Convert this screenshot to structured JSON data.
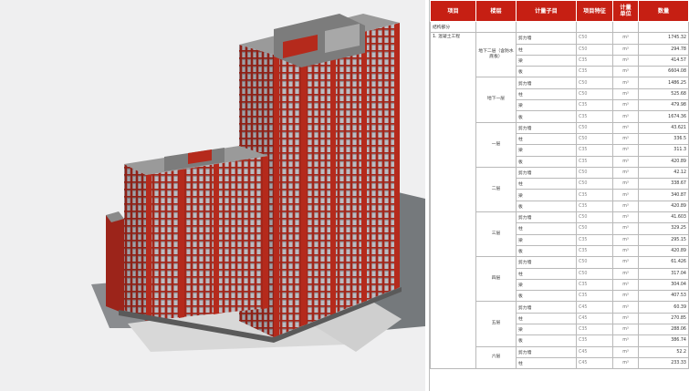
{
  "table": {
    "headers": [
      "项目",
      "楼层",
      "计量子目",
      "项目特征",
      "计量\n单位",
      "数量"
    ],
    "section": "结构部分",
    "item": "1. 混凝土工程",
    "floors": [
      {
        "name": "地下二层（含防水底板）",
        "rows": [
          {
            "sub": "剪力墙",
            "grade": "C50",
            "unit": "m³",
            "qty": "1745.32"
          },
          {
            "sub": "柱",
            "grade": "C50",
            "unit": "m³",
            "qty": "294.78"
          },
          {
            "sub": "梁",
            "grade": "C35",
            "unit": "m³",
            "qty": "414.57"
          },
          {
            "sub": "板",
            "grade": "C35",
            "unit": "m³",
            "qty": "6604.08"
          }
        ]
      },
      {
        "name": "地下一层",
        "rows": [
          {
            "sub": "剪力墙",
            "grade": "C50",
            "unit": "m³",
            "qty": "1486.25"
          },
          {
            "sub": "柱",
            "grade": "C50",
            "unit": "m³",
            "qty": "525.68"
          },
          {
            "sub": "梁",
            "grade": "C35",
            "unit": "m³",
            "qty": "479.98"
          },
          {
            "sub": "板",
            "grade": "C35",
            "unit": "m³",
            "qty": "1674.36"
          }
        ]
      },
      {
        "name": "一层",
        "rows": [
          {
            "sub": "剪力墙",
            "grade": "C50",
            "unit": "m³",
            "qty": "43.621"
          },
          {
            "sub": "柱",
            "grade": "C50",
            "unit": "m³",
            "qty": "336.5"
          },
          {
            "sub": "梁",
            "grade": "C35",
            "unit": "m³",
            "qty": "311.3"
          },
          {
            "sub": "板",
            "grade": "C35",
            "unit": "m³",
            "qty": "420.89"
          }
        ]
      },
      {
        "name": "二层",
        "rows": [
          {
            "sub": "剪力墙",
            "grade": "C50",
            "unit": "m³",
            "qty": "42.12"
          },
          {
            "sub": "柱",
            "grade": "C50",
            "unit": "m³",
            "qty": "338.67"
          },
          {
            "sub": "梁",
            "grade": "C35",
            "unit": "m³",
            "qty": "340.87"
          },
          {
            "sub": "板",
            "grade": "C35",
            "unit": "m³",
            "qty": "420.89"
          }
        ]
      },
      {
        "name": "三层",
        "rows": [
          {
            "sub": "剪力墙",
            "grade": "C50",
            "unit": "m³",
            "qty": "41.603"
          },
          {
            "sub": "柱",
            "grade": "C50",
            "unit": "m³",
            "qty": "329.25"
          },
          {
            "sub": "梁",
            "grade": "C35",
            "unit": "m³",
            "qty": "295.15"
          },
          {
            "sub": "板",
            "grade": "C35",
            "unit": "m³",
            "qty": "420.89"
          }
        ]
      },
      {
        "name": "四层",
        "rows": [
          {
            "sub": "剪力墙",
            "grade": "C50",
            "unit": "m³",
            "qty": "61.426"
          },
          {
            "sub": "柱",
            "grade": "C50",
            "unit": "m³",
            "qty": "317.04"
          },
          {
            "sub": "梁",
            "grade": "C35",
            "unit": "m³",
            "qty": "304.04"
          },
          {
            "sub": "板",
            "grade": "C35",
            "unit": "m³",
            "qty": "407.53"
          }
        ]
      },
      {
        "name": "五层",
        "rows": [
          {
            "sub": "剪力墙",
            "grade": "C45",
            "unit": "m³",
            "qty": "60.39"
          },
          {
            "sub": "柱",
            "grade": "C45",
            "unit": "m³",
            "qty": "270.85"
          },
          {
            "sub": "梁",
            "grade": "C35",
            "unit": "m³",
            "qty": "288.06"
          },
          {
            "sub": "板",
            "grade": "C35",
            "unit": "m³",
            "qty": "386.74"
          }
        ]
      },
      {
        "name": "六层",
        "rows": [
          {
            "sub": "剪力墙",
            "grade": "C45",
            "unit": "m³",
            "qty": "52.2"
          },
          {
            "sub": "柱",
            "grade": "C45",
            "unit": "m³",
            "qty": "233.33"
          }
        ]
      }
    ]
  },
  "colors": {
    "header_bg": "#c61f13",
    "facade_red": "#b52a1c",
    "roof_gray": "#9a9a9a",
    "background": "#efeff0"
  }
}
